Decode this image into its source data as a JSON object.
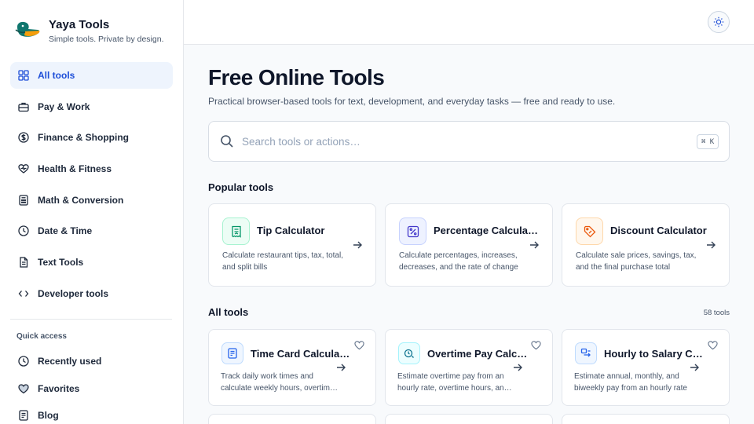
{
  "brand": {
    "name": "Yaya Tools",
    "tagline": "Simple tools. Private by design."
  },
  "sidebar": {
    "items": [
      {
        "label": "All tools",
        "icon": "grid-icon",
        "active": true
      },
      {
        "label": "Pay & Work",
        "icon": "briefcase-icon"
      },
      {
        "label": "Finance & Shopping",
        "icon": "dollar-circle-icon"
      },
      {
        "label": "Health & Fitness",
        "icon": "heart-pulse-icon"
      },
      {
        "label": "Math & Conversion",
        "icon": "calculator-icon"
      },
      {
        "label": "Date & Time",
        "icon": "clock-icon"
      },
      {
        "label": "Text Tools",
        "icon": "document-icon"
      },
      {
        "label": "Developer tools",
        "icon": "code-icon"
      }
    ],
    "quick_access_title": "Quick access",
    "quick_access": [
      {
        "label": "Recently used",
        "icon": "history-icon"
      },
      {
        "label": "Favorites",
        "icon": "heart-icon"
      },
      {
        "label": "Blog",
        "icon": "blog-icon"
      }
    ]
  },
  "topbar": {
    "theme_icon": "sun-icon"
  },
  "main": {
    "title": "Free Online Tools",
    "subtitle": "Practical browser-based tools for text, development, and everyday tasks — free and ready to use.",
    "search": {
      "placeholder": "Search tools or actions…",
      "shortcut": "⌘ K"
    },
    "popular_title": "Popular tools",
    "popular": [
      {
        "title": "Tip Calculator",
        "desc": "Calculate restaurant tips, tax, total, and split bills",
        "icon": "receipt-icon",
        "color": "#059669",
        "bg": "#ecfdf5",
        "border": "#a7f3d0"
      },
      {
        "title": "Percentage Calculator",
        "desc": "Calculate percentages, increases, decreases, and the rate of change",
        "icon": "percent-icon",
        "color": "#4338ca",
        "bg": "#eef2ff",
        "border": "#c7d2fe"
      },
      {
        "title": "Discount Calculator",
        "desc": "Calculate sale prices, savings, tax, and the final purchase total",
        "icon": "tag-icon",
        "color": "#ea580c",
        "bg": "#fff7ed",
        "border": "#fed7aa"
      }
    ],
    "all_title": "All tools",
    "all_count": "58 tools",
    "all": [
      {
        "title": "Time Card Calculator",
        "desc": "Track daily work times and calculate weekly hours, overtime, and pay",
        "icon": "timecard-icon",
        "color": "#2563eb",
        "bg": "#eff6ff",
        "border": "#bfdbfe"
      },
      {
        "title": "Overtime Pay Calculator",
        "desc": "Estimate overtime pay from an hourly rate, overtime hours, and multiplier",
        "icon": "clock-dollar-icon",
        "color": "#0e7490",
        "bg": "#ecfeff",
        "border": "#a5f3fc"
      },
      {
        "title": "Hourly to Salary Calculator",
        "desc": "Estimate annual, monthly, and biweekly pay from an hourly rate",
        "icon": "exchange-icon",
        "color": "#2563eb",
        "bg": "#eff6ff",
        "border": "#bfdbfe"
      }
    ]
  }
}
